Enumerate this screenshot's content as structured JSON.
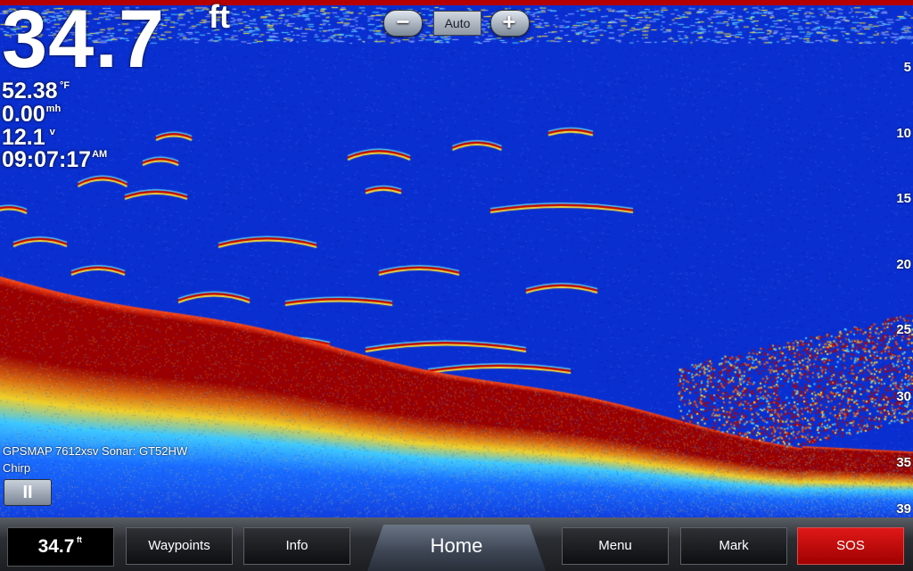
{
  "readouts": {
    "depth": "34.7",
    "depth_unit": "ft",
    "water_temp": "52.38",
    "water_temp_unit": "°F",
    "speed": "0.00",
    "speed_unit": "mh",
    "voltage": "12.1",
    "voltage_unit": "v",
    "time": "09:07:17",
    "time_ampm": "AM"
  },
  "zoom": {
    "minus_label": "−",
    "mode_label": "Auto",
    "plus_label": "+"
  },
  "depth_scale": [
    "5",
    "10",
    "15",
    "20",
    "25",
    "30",
    "35",
    "39"
  ],
  "sonar_info": {
    "device": "GPSMAP 7612xsv Sonar: GT52HW",
    "mode": "Chirp",
    "pause_label": "II"
  },
  "bottom_bar": {
    "depth_value": "34.7",
    "depth_unit": "ft",
    "waypoints_label": "Waypoints",
    "info_label": "Info",
    "home_label": "Home",
    "menu_label": "Menu",
    "mark_label": "Mark",
    "sos_label": "SOS"
  },
  "colors": {
    "water": "#0a2fd0",
    "bottom": "#9b0000",
    "sos": "#d01010",
    "accent": "#b40000"
  }
}
